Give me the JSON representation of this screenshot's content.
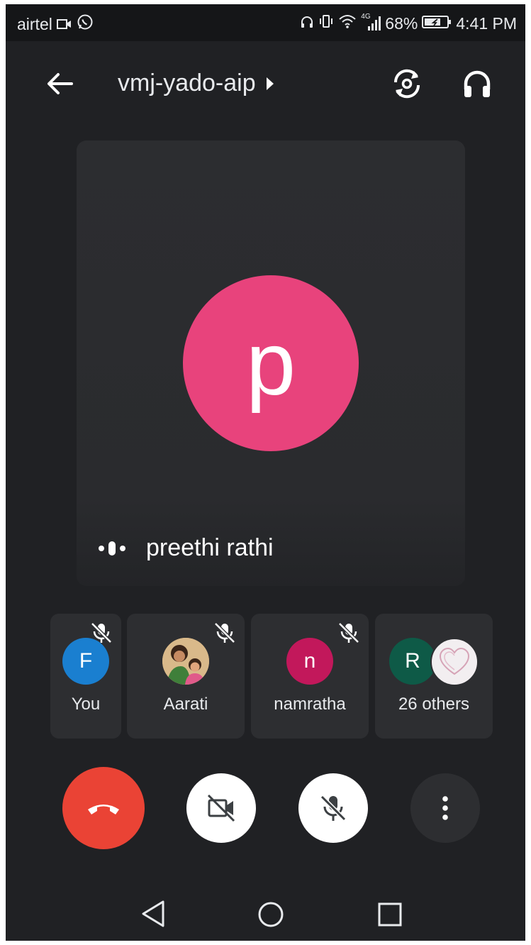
{
  "status_bar": {
    "carrier": "airtel",
    "network_label": "4G",
    "battery": "68%",
    "time": "4:41 PM"
  },
  "header": {
    "meeting_code": "vmj-yado-aip",
    "back_icon": "arrow-back-icon",
    "switch_camera_icon": "switch-camera-icon",
    "audio_icon": "headphones-icon"
  },
  "main_tile": {
    "avatar_initial": "p",
    "avatar_color": "#e8437c",
    "speaker_name": "preethi rathi"
  },
  "participants": [
    {
      "label": "You",
      "initial": "F",
      "color": "#1a7fd0",
      "muted": true
    },
    {
      "label": "Aarati",
      "initial": "",
      "photo": true,
      "muted": true
    },
    {
      "label": "namratha",
      "initial": "n",
      "color": "#c2185b",
      "muted": true
    },
    {
      "label": "26 others",
      "initial": "R",
      "color": "#0e5a47",
      "muted": false
    }
  ],
  "controls": {
    "end_call_color": "#ea4335",
    "end_call_icon": "end-call-icon",
    "camera_icon": "camera-off-icon",
    "mic_icon": "mic-off-icon",
    "more_icon": "more-options-icon"
  },
  "nav": [
    "back",
    "home",
    "recents"
  ]
}
